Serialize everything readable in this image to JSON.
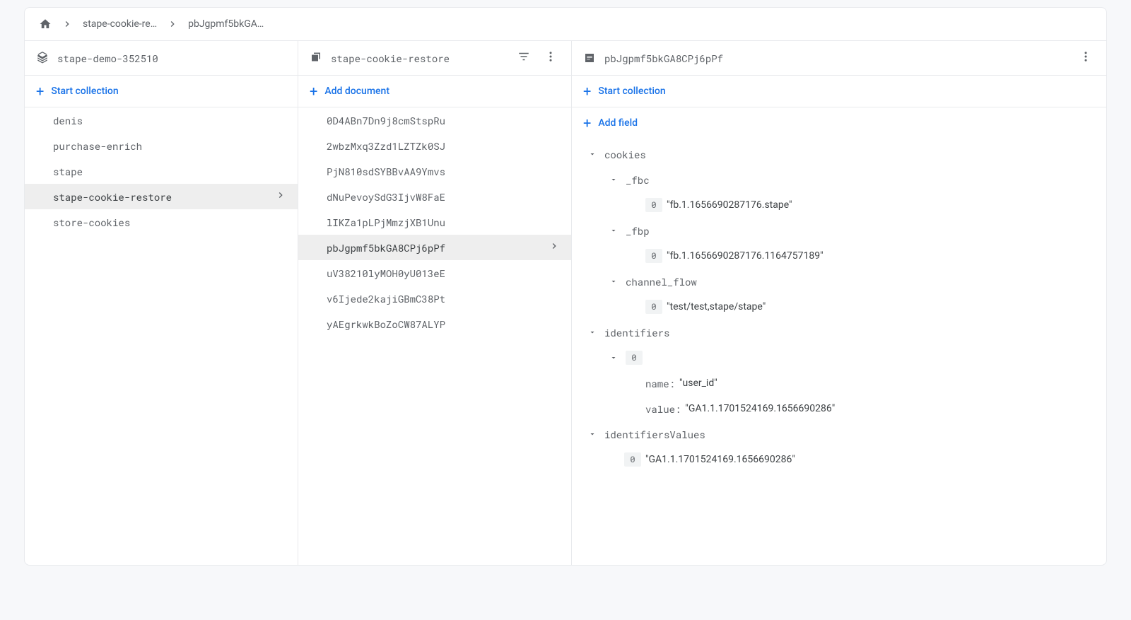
{
  "breadcrumb": {
    "items": [
      "stape-cookie-re…",
      "pbJgpmf5bkGA…"
    ]
  },
  "collections_panel": {
    "header_title": "stape-demo-352510",
    "start_collection_label": "Start collection",
    "items": [
      {
        "label": "denis",
        "selected": false
      },
      {
        "label": "purchase-enrich",
        "selected": false
      },
      {
        "label": "stape",
        "selected": false
      },
      {
        "label": "stape-cookie-restore",
        "selected": true
      },
      {
        "label": "store-cookies",
        "selected": false
      }
    ]
  },
  "documents_panel": {
    "header_title": "stape-cookie-restore",
    "add_document_label": "Add document",
    "items": [
      {
        "label": "0D4ABn7Dn9j8cmStspRu",
        "selected": false
      },
      {
        "label": "2wbzMxq3Zzd1LZTZk0SJ",
        "selected": false
      },
      {
        "label": "PjN810sdSYBBvAA9Ymvs",
        "selected": false
      },
      {
        "label": "dNuPevoySdG3IjvW8FaE",
        "selected": false
      },
      {
        "label": "lIKZa1pLPjMmzjXB1Unu",
        "selected": false
      },
      {
        "label": "pbJgpmf5bkGA8CPj6pPf",
        "selected": true
      },
      {
        "label": "uV38210lyMOH0yU013eE",
        "selected": false
      },
      {
        "label": "v6Ijede2kajiGBmC38Pt",
        "selected": false
      },
      {
        "label": "yAEgrkwkBoZoCW87ALYP",
        "selected": false
      }
    ]
  },
  "details_panel": {
    "header_title": "pbJgpmf5bkGA8CPj6pPf",
    "start_collection_label": "Start collection",
    "add_field_label": "Add field",
    "fields": {
      "cookies": {
        "_fbc": {
          "index": "0",
          "value": "\"fb.1.1656690287176.stape\""
        },
        "_fbp": {
          "index": "0",
          "value": "\"fb.1.1656690287176.1164757189\""
        },
        "channel_flow": {
          "index": "0",
          "value": "\"test/test,stape/stape\""
        }
      },
      "identifiers": {
        "item0": {
          "index": "0",
          "name_label": "name:",
          "name_value": "\"user_id\"",
          "value_label": "value:",
          "value_value": "\"GA1.1.1701524169.1656690286\""
        }
      },
      "identifiersValues": {
        "index": "0",
        "value": "\"GA1.1.1701524169.1656690286\""
      },
      "keys": {
        "cookies": "cookies",
        "_fbc": "_fbc",
        "_fbp": "_fbp",
        "channel_flow": "channel_flow",
        "identifiers": "identifiers",
        "identifiersValues": "identifiersValues"
      }
    }
  }
}
